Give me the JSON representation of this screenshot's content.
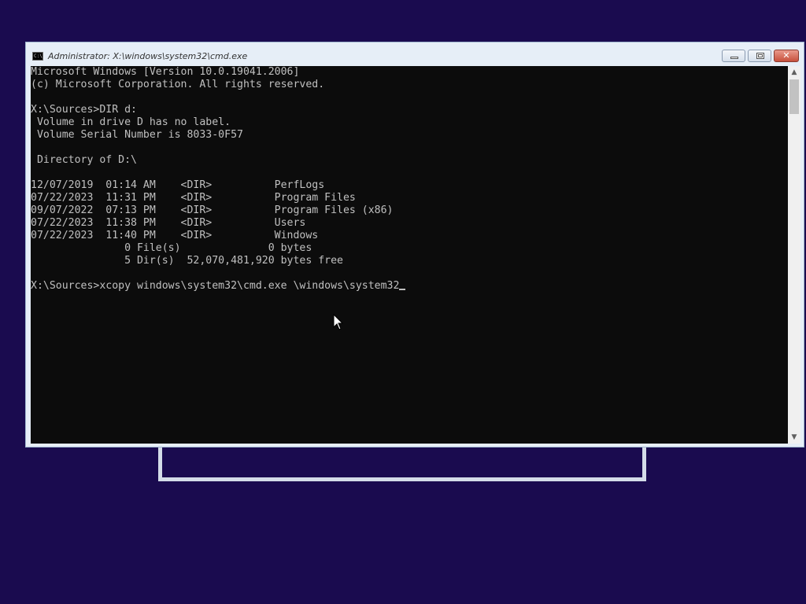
{
  "window": {
    "title": "Administrator: X:\\windows\\system32\\cmd.exe",
    "icon_label": "C:\\",
    "minimize_glyph": "minimize-icon",
    "maximize_glyph": "restore-icon",
    "close_glyph": "✕"
  },
  "console": {
    "lines": [
      "Microsoft Windows [Version 10.0.19041.2006]",
      "(c) Microsoft Corporation. All rights reserved.",
      "",
      "X:\\Sources>DIR d:",
      " Volume in drive D has no label.",
      " Volume Serial Number is 8033-0F57",
      "",
      " Directory of D:\\",
      "",
      "12/07/2019  01:14 AM    <DIR>          PerfLogs",
      "07/22/2023  11:31 PM    <DIR>          Program Files",
      "09/07/2022  07:13 PM    <DIR>          Program Files (x86)",
      "07/22/2023  11:38 PM    <DIR>          Users",
      "07/22/2023  11:40 PM    <DIR>          Windows",
      "               0 File(s)              0 bytes",
      "               5 Dir(s)  52,070,481,920 bytes free",
      ""
    ],
    "current_command": "X:\\Sources>xcopy windows\\system32\\cmd.exe \\windows\\system32"
  },
  "scrollbar": {
    "up_arrow": "▲",
    "down_arrow": "▼"
  },
  "colors": {
    "desktop_background": "#1a0b4f",
    "console_background": "#0c0c0c",
    "console_text": "#c0c0c0",
    "close_button": "#c7503c"
  }
}
